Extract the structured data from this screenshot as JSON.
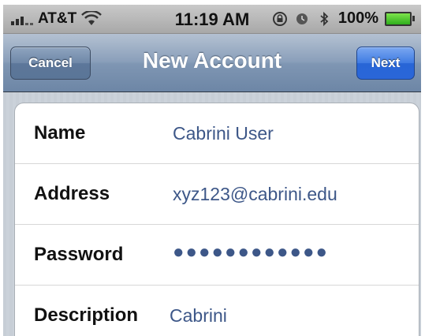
{
  "status_bar": {
    "carrier": "AT&T",
    "time": "11:19 AM",
    "battery": "100%"
  },
  "nav": {
    "title": "New Account",
    "cancel_label": "Cancel",
    "next_label": "Next"
  },
  "form": {
    "rows": [
      {
        "label": "Name",
        "value": "Cabrini User"
      },
      {
        "label": "Address",
        "value": "xyz123@cabrini.edu"
      },
      {
        "label": "Password",
        "value": "●●●●●●●●●●●●"
      },
      {
        "label": "Description",
        "value": "Cabrini"
      }
    ]
  },
  "colors": {
    "value_text": "#3d5788",
    "nav_bar": "#7f96b3",
    "next_button": "#2a66d9"
  },
  "icons": [
    "signal-icon",
    "wifi-icon",
    "lock-rotation-icon",
    "alarm-icon",
    "bluetooth-icon",
    "battery-icon"
  ]
}
